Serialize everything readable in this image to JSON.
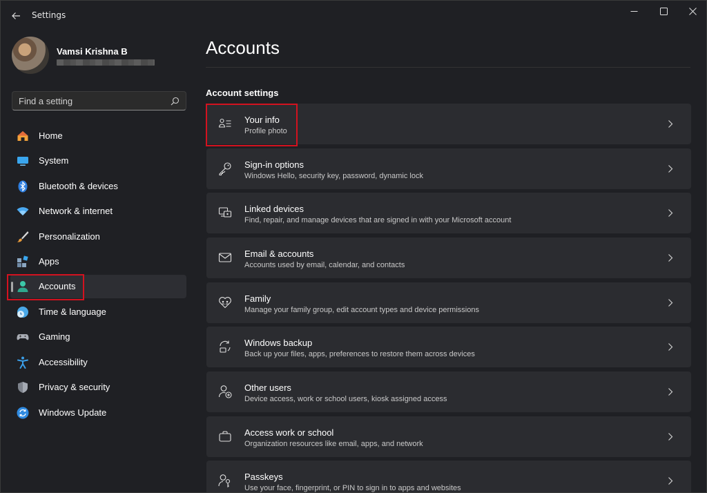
{
  "window": {
    "title": "Settings",
    "controls": [
      "minimize-icon",
      "maximize-icon",
      "close-icon"
    ]
  },
  "profile": {
    "name": "Vamsi Krishna B"
  },
  "search": {
    "placeholder": "Find a setting"
  },
  "sidebar": {
    "items": [
      {
        "label": "Home",
        "icon": "home-icon",
        "color": "#f0a040"
      },
      {
        "label": "System",
        "icon": "system-icon",
        "color": "#3aa0e8"
      },
      {
        "label": "Bluetooth & devices",
        "icon": "bluetooth-icon",
        "color": "#2f7fe0"
      },
      {
        "label": "Network & internet",
        "icon": "wifi-icon",
        "color": "#4aa8f0"
      },
      {
        "label": "Personalization",
        "icon": "brush-icon",
        "color": "#e8a050"
      },
      {
        "label": "Apps",
        "icon": "apps-icon",
        "color": "#7a9ab8"
      },
      {
        "label": "Accounts",
        "icon": "person-icon",
        "color": "#3cc8a8"
      },
      {
        "label": "Time & language",
        "icon": "globe-clock-icon",
        "color": "#4aa8e8"
      },
      {
        "label": "Gaming",
        "icon": "gamepad-icon",
        "color": "#a0a0a8"
      },
      {
        "label": "Accessibility",
        "icon": "accessibility-icon",
        "color": "#3a9ee8"
      },
      {
        "label": "Privacy & security",
        "icon": "shield-icon",
        "color": "#8a8e98"
      },
      {
        "label": "Windows Update",
        "icon": "update-icon",
        "color": "#2f8ae0"
      }
    ],
    "selected": "Accounts"
  },
  "main": {
    "title": "Accounts",
    "section_title": "Account settings",
    "cards": [
      {
        "title": "Your info",
        "subtitle": "Profile photo",
        "icon": "person-card-icon"
      },
      {
        "title": "Sign-in options",
        "subtitle": "Windows Hello, security key, password, dynamic lock",
        "icon": "key-icon"
      },
      {
        "title": "Linked devices",
        "subtitle": "Find, repair, and manage devices that are signed in with your Microsoft account",
        "icon": "linked-devices-icon"
      },
      {
        "title": "Email & accounts",
        "subtitle": "Accounts used by email, calendar, and contacts",
        "icon": "mail-icon"
      },
      {
        "title": "Family",
        "subtitle": "Manage your family group, edit account types and device permissions",
        "icon": "family-heart-icon"
      },
      {
        "title": "Windows backup",
        "subtitle": "Back up your files, apps, preferences to restore them across devices",
        "icon": "backup-icon"
      },
      {
        "title": "Other users",
        "subtitle": "Device access, work or school users, kiosk assigned access",
        "icon": "add-user-icon"
      },
      {
        "title": "Access work or school",
        "subtitle": "Organization resources like email, apps, and network",
        "icon": "briefcase-icon"
      },
      {
        "title": "Passkeys",
        "subtitle": "Use your face, fingerprint, or PIN to sign in to apps and websites",
        "icon": "passkey-icon"
      }
    ]
  },
  "colors": {
    "highlight": "#d4121f",
    "background": "#1f2024",
    "card": "#2b2c30"
  }
}
